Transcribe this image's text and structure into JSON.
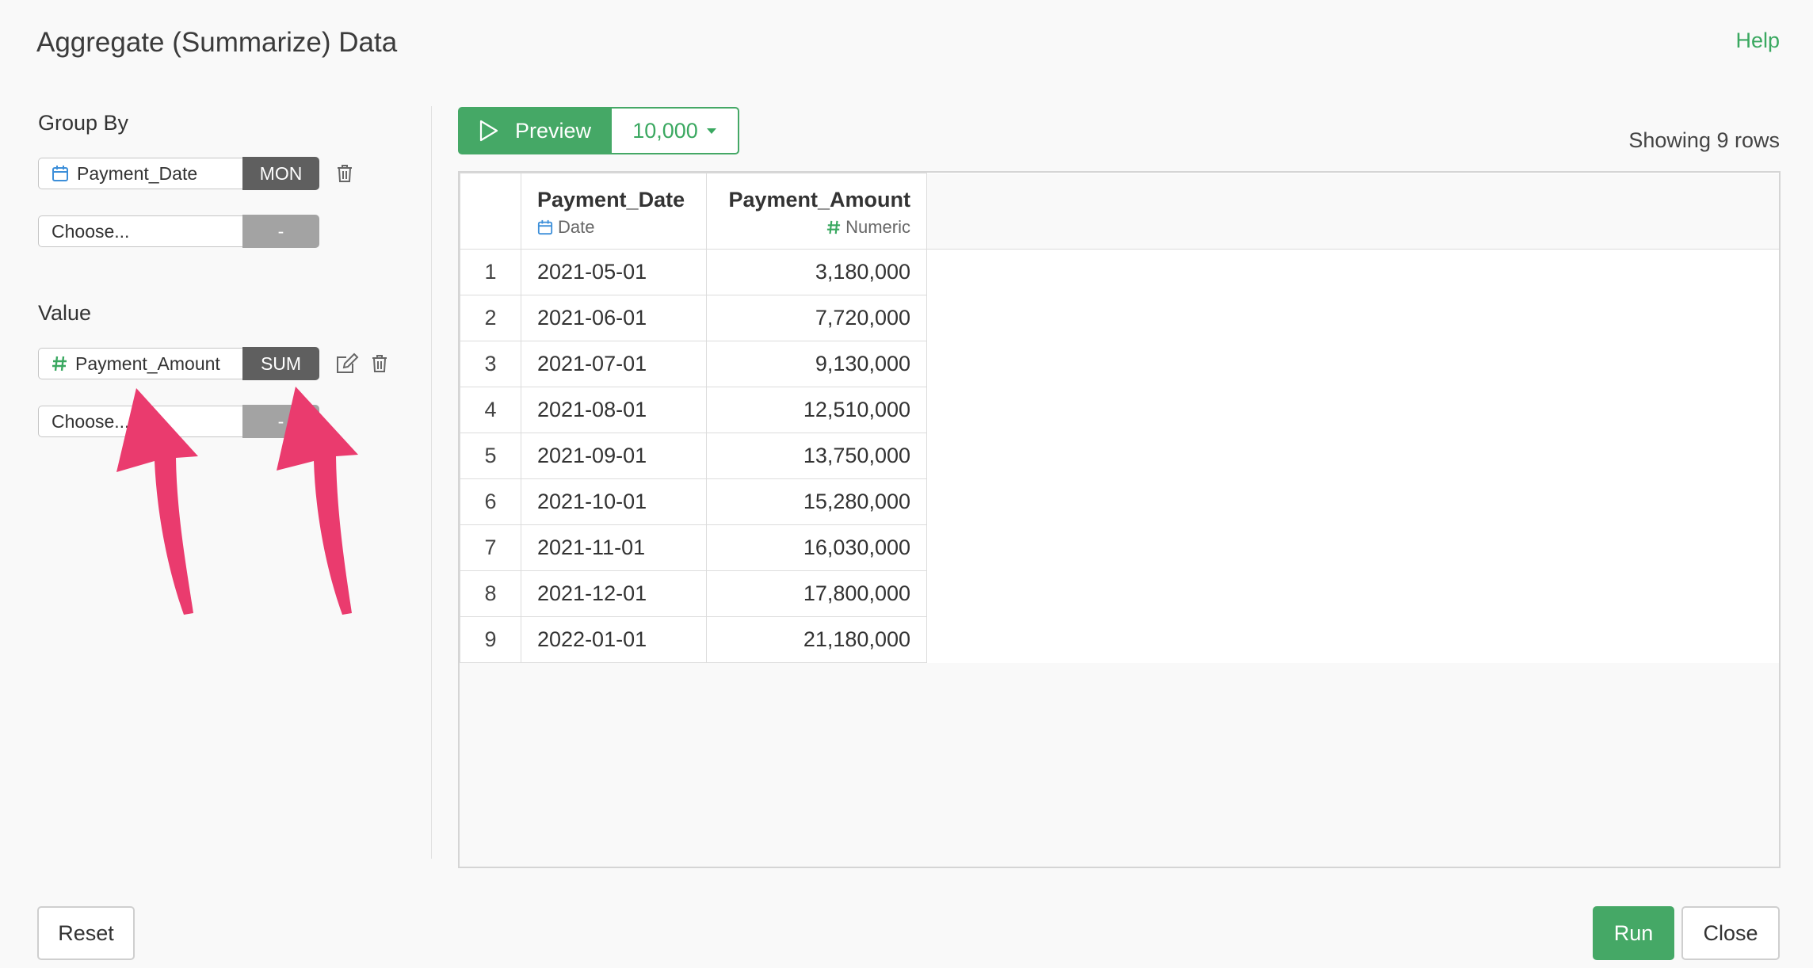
{
  "dialog": {
    "title": "Aggregate (Summarize) Data",
    "help_label": "Help"
  },
  "group_by": {
    "label": "Group By",
    "field": {
      "name": "Payment_Date",
      "type_icon": "calendar-icon",
      "aggregation": "MON"
    },
    "placeholder": {
      "name": "Choose...",
      "aggregation": "-"
    }
  },
  "value": {
    "label": "Value",
    "field": {
      "name": "Payment_Amount",
      "type_icon": "hash-icon",
      "aggregation": "SUM"
    },
    "placeholder": {
      "name": "Choose...",
      "aggregation": "-"
    }
  },
  "preview": {
    "button_label": "Preview",
    "row_limit": "10,000",
    "showing_text": "Showing 9 rows"
  },
  "table": {
    "columns": [
      {
        "name": "Payment_Date",
        "type": "Date"
      },
      {
        "name": "Payment_Amount",
        "type": "Numeric"
      }
    ],
    "rows": [
      {
        "index": "1",
        "date": "2021-05-01",
        "amount": "3,180,000"
      },
      {
        "index": "2",
        "date": "2021-06-01",
        "amount": "7,720,000"
      },
      {
        "index": "3",
        "date": "2021-07-01",
        "amount": "9,130,000"
      },
      {
        "index": "4",
        "date": "2021-08-01",
        "amount": "12,510,000"
      },
      {
        "index": "5",
        "date": "2021-09-01",
        "amount": "13,750,000"
      },
      {
        "index": "6",
        "date": "2021-10-01",
        "amount": "15,280,000"
      },
      {
        "index": "7",
        "date": "2021-11-01",
        "amount": "16,030,000"
      },
      {
        "index": "8",
        "date": "2021-12-01",
        "amount": "17,800,000"
      },
      {
        "index": "9",
        "date": "2022-01-01",
        "amount": "21,180,000"
      }
    ]
  },
  "footer": {
    "reset_label": "Reset",
    "run_label": "Run",
    "close_label": "Close"
  },
  "colors": {
    "accent": "#45a866",
    "dark_button": "#5f5f5f",
    "annotation_arrow": "#ea3b6e",
    "calendar": "#3d8fd9"
  }
}
